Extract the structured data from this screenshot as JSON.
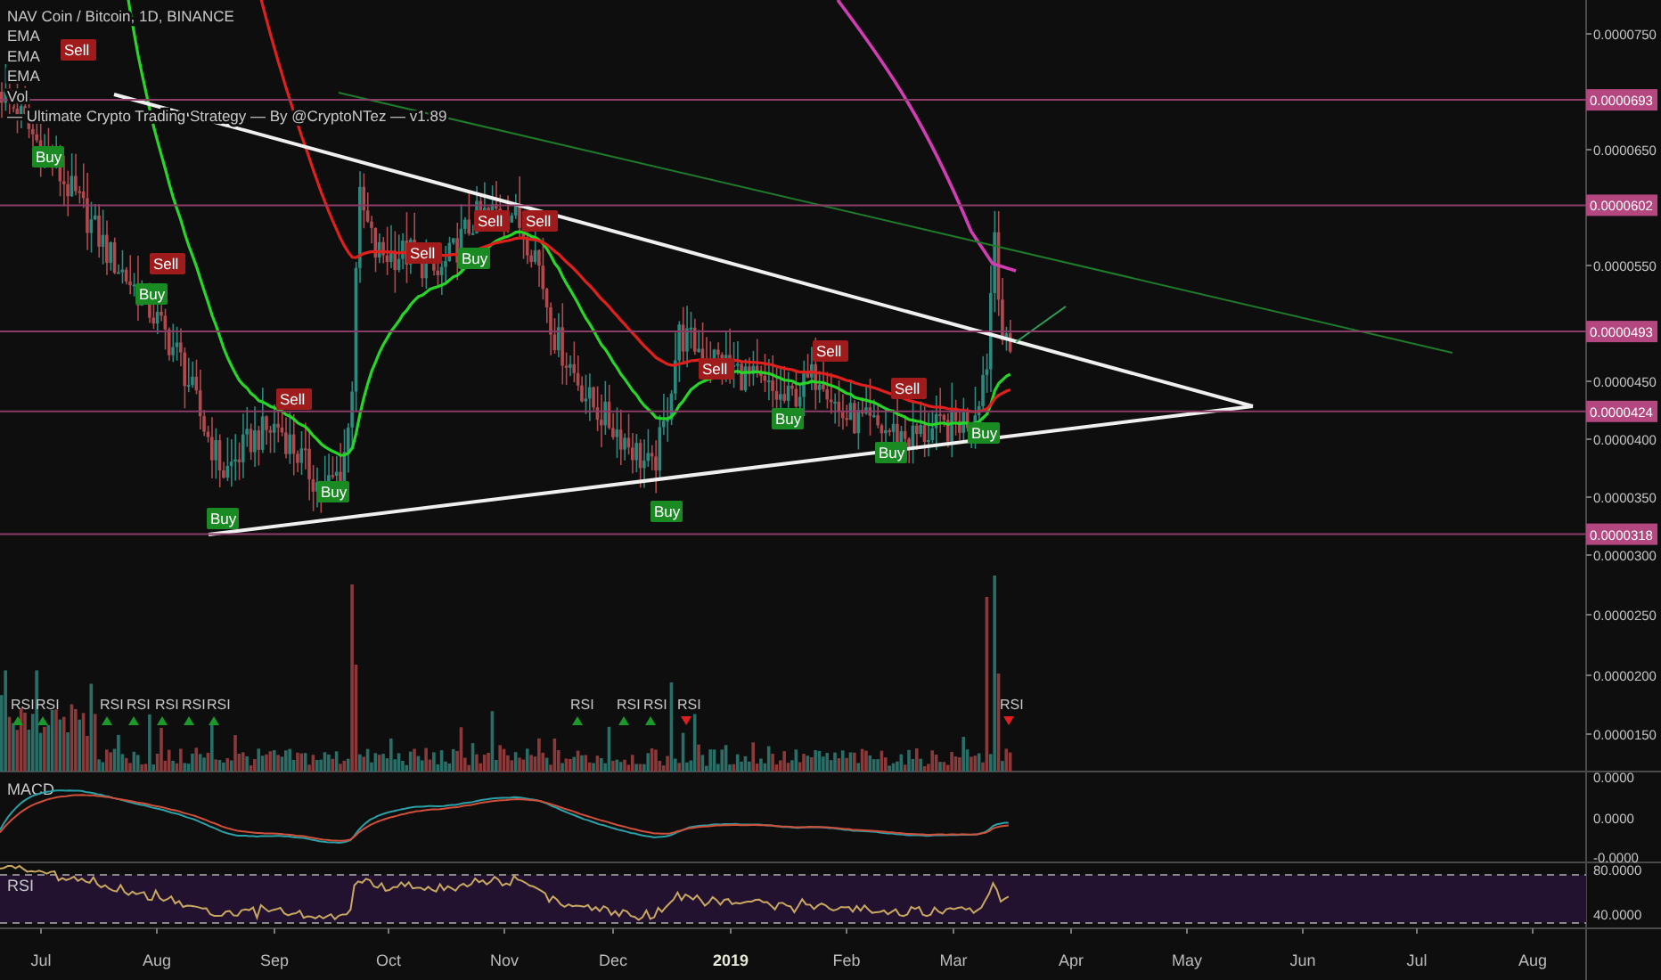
{
  "legend": {
    "symbol": "NAV Coin / Bitcoin, 1D, BINANCE",
    "studies": [
      "EMA",
      "EMA",
      "EMA",
      "Vol",
      "— Ultimate Crypto Trading Strategy — By @CryptoNTez — v1.89"
    ]
  },
  "price_axis": {
    "ticks": [
      "0.0000750",
      "0.0000650",
      "0.0000550",
      "0.0000450",
      "0.0000400",
      "0.0000350",
      "0.0000300"
    ]
  },
  "levels": [
    {
      "label": "0.0000693"
    },
    {
      "label": "0.0000602"
    },
    {
      "label": "0.0000493"
    },
    {
      "label": "0.0000424"
    },
    {
      "label": "0.0000318"
    }
  ],
  "signals": [
    {
      "kind": "sell",
      "label": "Sell"
    },
    {
      "kind": "buy",
      "label": "Buy"
    },
    {
      "kind": "sell",
      "label": "Sell"
    },
    {
      "kind": "buy",
      "label": "Buy"
    },
    {
      "kind": "sell",
      "label": "Sell"
    },
    {
      "kind": "buy",
      "label": "Buy"
    },
    {
      "kind": "buy",
      "label": "Buy"
    },
    {
      "kind": "sell",
      "label": "Sell"
    },
    {
      "kind": "buy",
      "label": "Buy"
    },
    {
      "kind": "sell",
      "label": "Sell"
    },
    {
      "kind": "sell",
      "label": "Sell"
    },
    {
      "kind": "buy",
      "label": "Buy"
    },
    {
      "kind": "sell",
      "label": "Sell"
    },
    {
      "kind": "buy",
      "label": "Buy"
    },
    {
      "kind": "sell",
      "label": "Sell"
    },
    {
      "kind": "buy",
      "label": "Buy"
    },
    {
      "kind": "sell",
      "label": "Sell"
    },
    {
      "kind": "buy",
      "label": "Buy"
    }
  ],
  "volume_pane": {
    "axis_ticks": [
      "0.0000250",
      "0.0000200",
      "0.0000150"
    ],
    "markers": [
      {
        "kind": "up",
        "label": "RSI"
      },
      {
        "kind": "up",
        "label": "RSI"
      },
      {
        "kind": "up",
        "label": "RSI"
      },
      {
        "kind": "up",
        "label": "RSI"
      },
      {
        "kind": "up",
        "label": "RSI"
      },
      {
        "kind": "up",
        "label": "RSI"
      },
      {
        "kind": "up",
        "label": "RSI"
      },
      {
        "kind": "up",
        "label": "RSI"
      },
      {
        "kind": "up",
        "label": "RSI"
      },
      {
        "kind": "up",
        "label": "RSI"
      },
      {
        "kind": "down",
        "label": "RSI"
      },
      {
        "kind": "down",
        "label": "RSI"
      }
    ]
  },
  "macd_pane": {
    "title": "MACD",
    "axis_ticks": [
      "0.0000",
      "0.0000",
      "-0.0000"
    ]
  },
  "rsi_pane": {
    "title": "RSI",
    "axis_ticks": [
      "80.0000",
      "40.0000"
    ]
  },
  "time_axis": [
    {
      "kind": "month",
      "label": "Jul"
    },
    {
      "kind": "month",
      "label": "Aug"
    },
    {
      "kind": "month",
      "label": "Sep"
    },
    {
      "kind": "month",
      "label": "Oct"
    },
    {
      "kind": "month",
      "label": "Nov"
    },
    {
      "kind": "month",
      "label": "Dec"
    },
    {
      "kind": "year",
      "label": "2019"
    },
    {
      "kind": "month",
      "label": "Feb"
    },
    {
      "kind": "month",
      "label": "Mar"
    },
    {
      "kind": "month",
      "label": "Apr"
    },
    {
      "kind": "month",
      "label": "May"
    },
    {
      "kind": "month",
      "label": "Jun"
    },
    {
      "kind": "month",
      "label": "Jul"
    },
    {
      "kind": "month",
      "label": "Aug"
    }
  ]
}
